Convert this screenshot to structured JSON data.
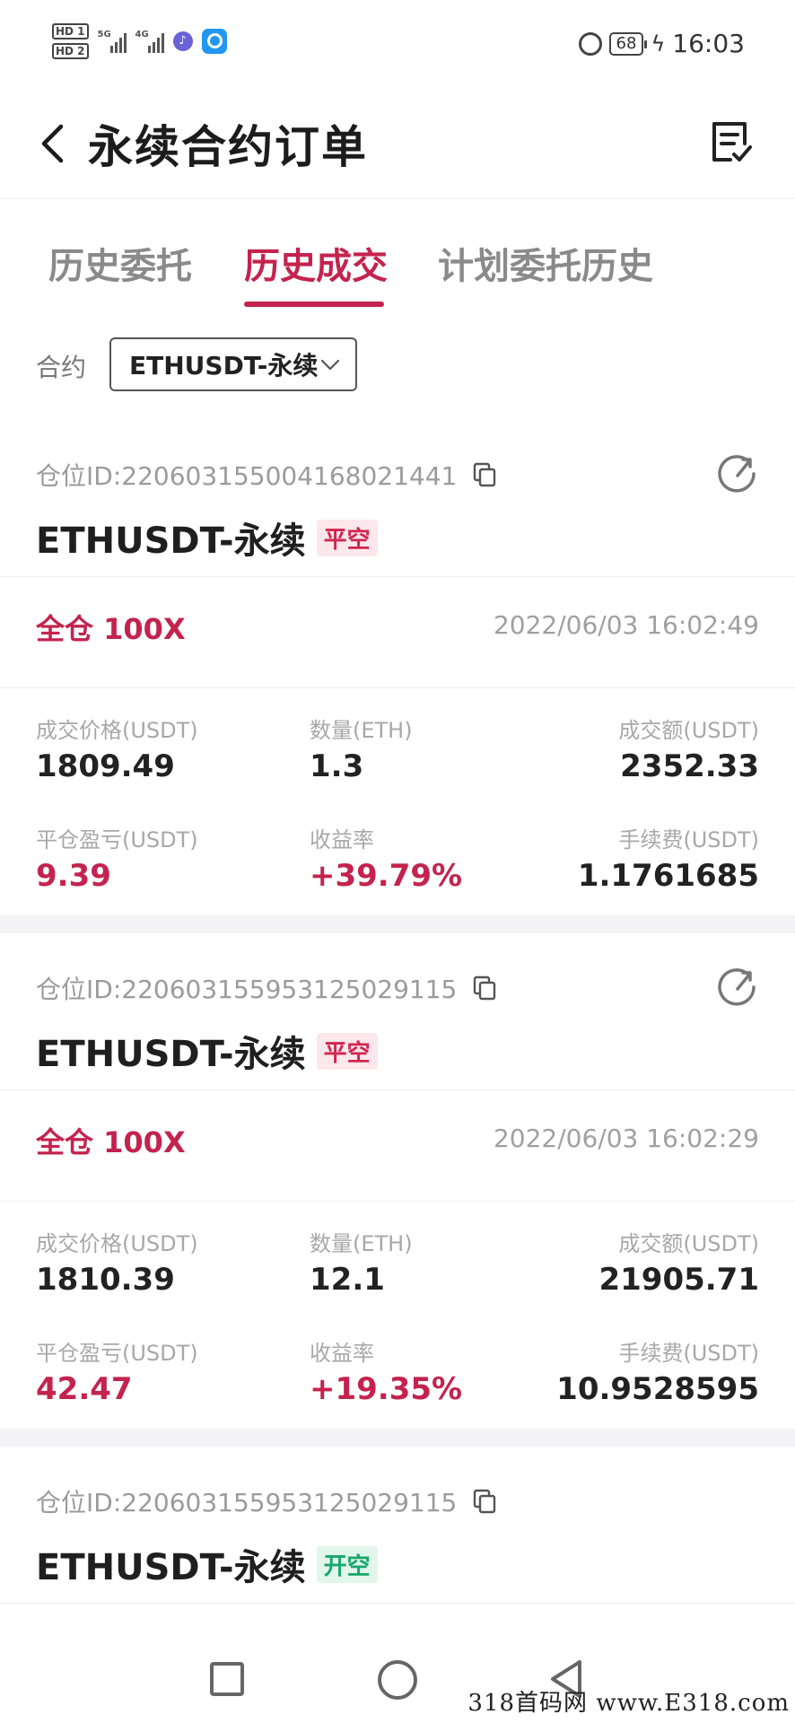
{
  "status_bar": {
    "hd1": "HD 1",
    "hd2": "HD 2",
    "net1": "5G",
    "net2": "4G",
    "battery": "68",
    "time": "16:03"
  },
  "header": {
    "title": "永续合约订单"
  },
  "tabs": [
    {
      "label": "历史委托",
      "active": false
    },
    {
      "label": "历史成交",
      "active": true
    },
    {
      "label": "计划委托历史",
      "active": false
    }
  ],
  "filter": {
    "label": "合约",
    "value": "ETHUSDT-永续"
  },
  "orders": [
    {
      "position_id": "仓位ID:22060315500416802144​1",
      "symbol": "ETHUSDT-永续",
      "tag": "平空",
      "tag_color": "red",
      "leverage": "全仓 100X",
      "time": "2022/06/03 16:02:49",
      "price_label": "成交价格(USDT)",
      "price": "1809.49",
      "qty_label": "数量(ETH)",
      "qty": "1.3",
      "amount_label": "成交额(USDT)",
      "amount": "2352.33",
      "pnl_label": "平仓盈亏(USDT)",
      "pnl": "9.39",
      "roi_label": "收益率",
      "roi": "+39.79%",
      "fee_label": "手续费(USDT)",
      "fee": "1.1761685"
    },
    {
      "position_id": "仓位ID:220603155953125029115",
      "symbol": "ETHUSDT-永续",
      "tag": "平空",
      "tag_color": "red",
      "leverage": "全仓 100X",
      "time": "2022/06/03 16:02:29",
      "price_label": "成交价格(USDT)",
      "price": "1810.39",
      "qty_label": "数量(ETH)",
      "qty": "12.1",
      "amount_label": "成交额(USDT)",
      "amount": "21905.71",
      "pnl_label": "平仓盈亏(USDT)",
      "pnl": "42.47",
      "roi_label": "收益率",
      "roi": "+19.35%",
      "fee_label": "手续费(USDT)",
      "fee": "10.9528595"
    },
    {
      "position_id": "仓位ID:220603155953125029115",
      "symbol": "ETHUSDT-永续",
      "tag": "开空",
      "tag_color": "green"
    }
  ],
  "watermark": "318首码网 www.E318.com",
  "colors": {
    "accent": "#c4234e",
    "green": "#16a86a",
    "text": "#1f1f1f",
    "muted": "#a0a0a0"
  },
  "icons": {
    "back": "chevron-left-icon",
    "note": "note-check-icon",
    "copy": "copy-icon",
    "share": "share-icon",
    "dropdown": "chevron-down-icon"
  }
}
